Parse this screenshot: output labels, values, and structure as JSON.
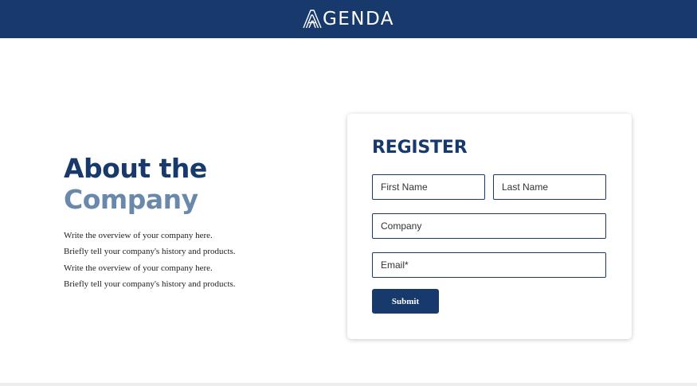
{
  "header": {
    "logo_text": "GENDA",
    "logo_icon": "stylized-a-logo-icon",
    "background": "#17396b"
  },
  "about": {
    "title_line1": "About the",
    "title_line2": "Company",
    "paragraphs": [
      "Write the overview of your company here.",
      "Briefly tell your company's history and products.",
      "Write the overview of your company here.",
      "Briefly tell your company's history and products."
    ]
  },
  "register": {
    "title": "REGISTER",
    "first_name_placeholder": "First Name",
    "last_name_placeholder": "Last Name",
    "company_placeholder": "Company",
    "email_placeholder": "Email*",
    "submit_label": "Submit"
  },
  "colors": {
    "primary": "#17396b",
    "secondary": "#6a88aa",
    "background": "#ffffff"
  }
}
